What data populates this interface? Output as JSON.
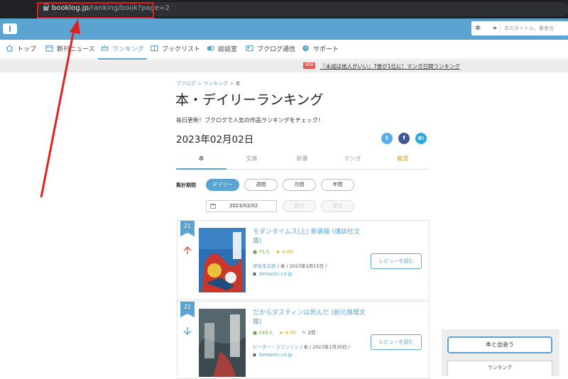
{
  "browser": {
    "back_glyph": "←",
    "forward_glyph": "→",
    "reload_glyph": "↻",
    "url_host": "booklog.jp",
    "url_path": "/ranking/book?page=2"
  },
  "header": {
    "search_select": "本",
    "search_placeholder": "本のタイトル、著者名"
  },
  "nav": {
    "items": [
      {
        "label": "トップ",
        "icon": "home-icon"
      },
      {
        "label": "新刊ニュース",
        "icon": "calendar-icon"
      },
      {
        "label": "ランキング",
        "icon": "crown-icon"
      },
      {
        "label": "ブックリスト",
        "icon": "booklist-icon"
      },
      {
        "label": "談話室",
        "icon": "chat-icon"
      },
      {
        "label": "ブクログ通信",
        "icon": "news-icon"
      },
      {
        "label": "サポート",
        "icon": "help-icon"
      }
    ]
  },
  "announcement": {
    "badge": "NEW",
    "text": "『未成は他人がいい』7巻が1位に！マンガ日間ランキング"
  },
  "breadcrumb": {
    "home": "ブクログ",
    "ranking": "ランキング",
    "current": "本",
    "sep": ">"
  },
  "page": {
    "title": "本・デイリーランキング",
    "subtitle": "毎日更新！ブクログで人気の作品ランキングをチェック！",
    "date": "2023年02月02日"
  },
  "social": {
    "twitter": "t",
    "facebook": "f",
    "hatena": "B!"
  },
  "tabs": [
    "本",
    "文庫",
    "新書",
    "マンガ",
    "殿堂"
  ],
  "period": {
    "label": "集計期間",
    "options": [
      "デイリー",
      "週間",
      "月間",
      "年間"
    ],
    "date_value": "2023/02/02",
    "prev": "前日",
    "next": "翌日"
  },
  "ranking": [
    {
      "rank": "21",
      "trend": "↑",
      "title": "モダンタイムス(上) 新装版 (講談社文庫)",
      "readers": "71人",
      "rating": "4.00",
      "author": "伊坂幸太郎",
      "category": "本",
      "date": "2023年2月15日",
      "store": "Amazon.co.jp",
      "review_button": "レビューを読む"
    },
    {
      "rank": "22",
      "trend": "↓",
      "title": "だからダスティンは死んだ (創元推理文庫)",
      "readers": "245人",
      "rating": "4.00",
      "reviews": "2件",
      "author": "ピーター・スワンソン",
      "category": "本",
      "date": "2023年1月30日",
      "store": "Amazon.co.jp",
      "review_button": "レビューを読む"
    }
  ],
  "sidebar": {
    "meet_button": "本と出会う",
    "ranking_box": "ランキング"
  },
  "colors": {
    "accent": "#5ba3d0",
    "annotation": "#e02020"
  }
}
